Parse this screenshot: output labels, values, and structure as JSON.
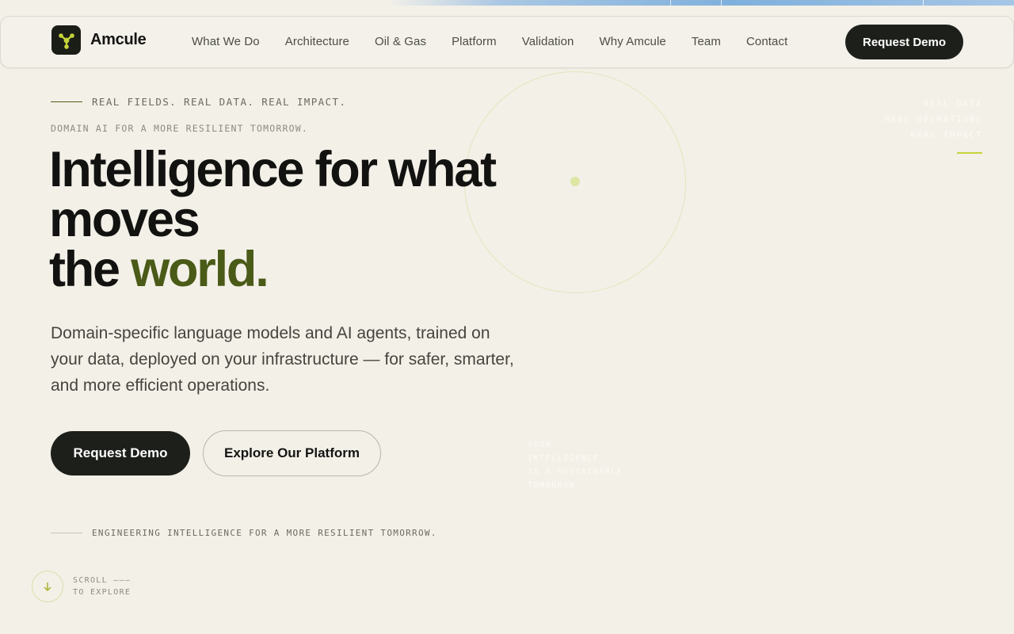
{
  "brand": {
    "name": "Amcule",
    "logo_icon": "molecule-icon",
    "accent_color": "#c6d43a"
  },
  "nav": {
    "items": [
      {
        "label": "What We Do"
      },
      {
        "label": "Architecture"
      },
      {
        "label": "Oil & Gas"
      },
      {
        "label": "Platform"
      },
      {
        "label": "Validation"
      },
      {
        "label": "Why Amcule"
      },
      {
        "label": "Team"
      },
      {
        "label": "Contact"
      }
    ],
    "cta_label": "Request Demo"
  },
  "hero": {
    "eyebrow": "REAL FIELDS. REAL DATA. REAL IMPACT.",
    "subeyebrow": "DOMAIN AI FOR A MORE RESILIENT TOMORROW.",
    "headline_line1": "Intelligence for what",
    "headline_line2": "moves",
    "headline_line3_plain": "the ",
    "headline_line3_accent": "world.",
    "lead": "Domain-specific language models and AI agents, trained on your data, deployed on your infrastructure — for safer, smarter, and more efficient operations.",
    "primary_cta": "Request Demo",
    "secondary_cta": "Explore Our Platform",
    "tagline": "ENGINEERING INTELLIGENCE FOR A MORE RESILIENT TOMORROW.",
    "accent_color": "#4a5a17"
  },
  "scroll": {
    "line1": "SCROLL ———",
    "line2": "TO EXPLORE",
    "icon": "arrow-down-icon"
  },
  "decor": {
    "right_lines": [
      "REAL DATA",
      "REAL OPERATIONS",
      "REAL IMPACT"
    ],
    "mid_lines": [
      "YOUR",
      "INTELLIGENCE",
      "IS A SUSTAINABLE",
      "TOMORROW"
    ]
  }
}
